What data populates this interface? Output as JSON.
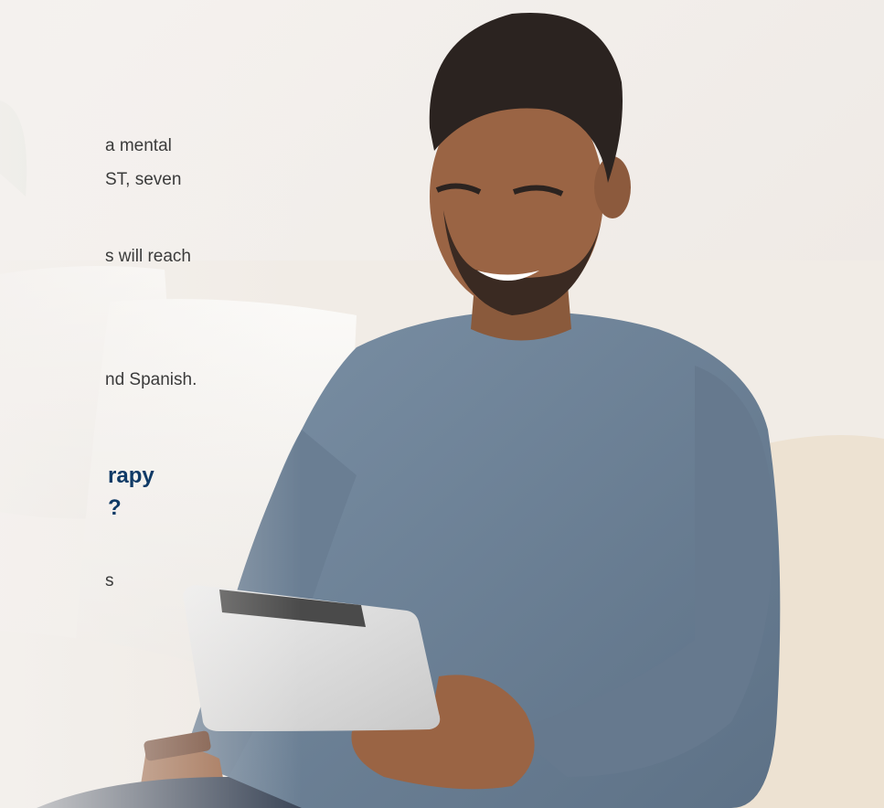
{
  "text_fragments": {
    "line1": "a mental",
    "line2": "ST, seven",
    "line3": "s will reach",
    "line4": "nd Spanish.",
    "heading_line1": "rapy",
    "heading_line2": "?",
    "line5": "s"
  },
  "colors": {
    "background": "#f3efec",
    "heading": "#0f3a66",
    "body_text": "#3b3b3b",
    "sweater": "#6d8196",
    "tablet": "#dcdcdc"
  }
}
